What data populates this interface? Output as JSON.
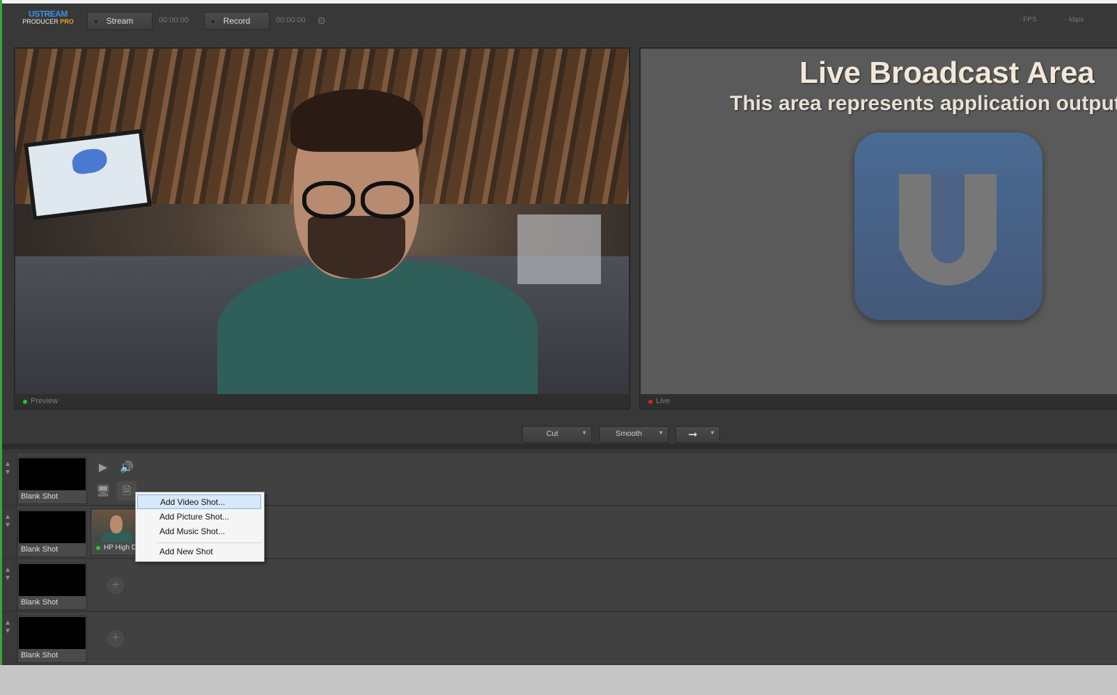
{
  "app": {
    "logo_line1": "USTREAM",
    "logo_line2": "PRODUCER",
    "logo_line2_accent": "PRO"
  },
  "toolbar": {
    "stream_label": "Stream",
    "stream_timer": "00:00:00",
    "record_label": "Record",
    "record_timer": "00:00:00",
    "settings_icon": "gear-icon",
    "fps": "- FPS",
    "kbps": "- kbps"
  },
  "preview": {
    "label": "Preview",
    "status_color": "#22cc22"
  },
  "live": {
    "title": "Live Broadcast Area",
    "subtitle": "This area represents application output",
    "label": "Live",
    "status_color": "#e02020"
  },
  "transitions": {
    "cut_label": "Cut",
    "smooth_label": "Smooth",
    "go_icon": "arrow-right-icon"
  },
  "shot_rows": [
    {
      "shot_name": "Blank Shot"
    },
    {
      "shot_name": "Blank Shot",
      "camera_shot_name": "HP High Definition"
    },
    {
      "shot_name": "Blank Shot"
    },
    {
      "shot_name": "Blank Shot"
    }
  ],
  "context_menu": {
    "items": [
      "Add Video Shot...",
      "Add Picture Shot...",
      "Add Music Shot...",
      "Add New Shot"
    ],
    "highlighted": "Add Video Shot..."
  },
  "colors": {
    "accent_blue": "#3f8fe3",
    "accent_orange": "#f0a020"
  }
}
